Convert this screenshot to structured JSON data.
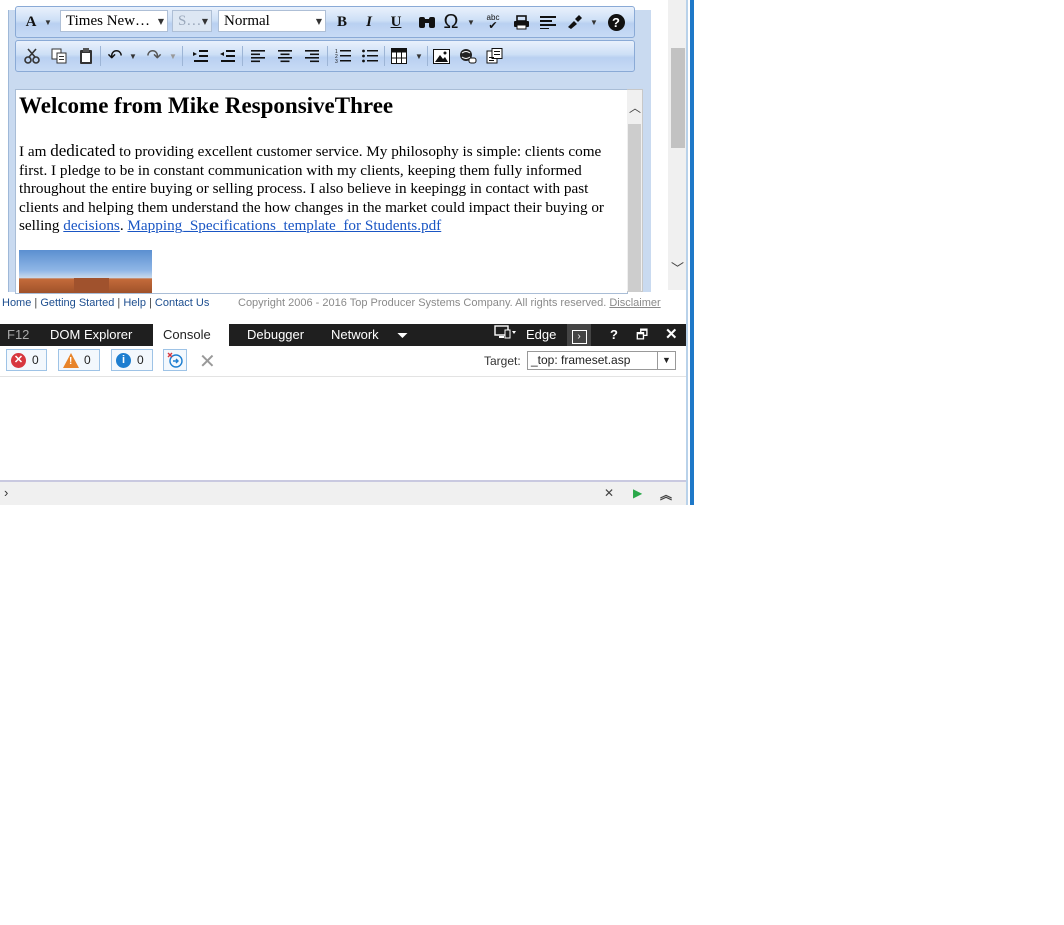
{
  "editor": {
    "toolbar1": {
      "font_name": "Times New…",
      "font_size": "S…",
      "paragraph_format": "Normal",
      "bold": "B",
      "italic": "I",
      "underline": "U",
      "font_color": "A",
      "help": "?",
      "spellcheck": "abc"
    },
    "content": {
      "heading": "Welcome from Mike ResponsiveThree",
      "para_start": "I am ",
      "para_big": "dedicated",
      "para_body": "  to providing excellent customer service. My philosophy is simple: clients come first. I pledge to be in constant communication with my clients, keeping them fully informed throughout the entire buying or selling process. I also believe in keepingg in contact with past clients and helping them understand the how changes in the market could impact their buying or selling ",
      "link1": "decisions",
      "between_links": ". ",
      "link2": "Mapping_Specifications_template_for Students.pdf"
    }
  },
  "footer": {
    "links": [
      "Home",
      "Getting Started",
      "Help",
      "Contact Us"
    ],
    "separator": "|",
    "copyright": "Copyright 2006 - 2016 Top Producer Systems Company. All rights reserved.",
    "disclaimer": "Disclaimer"
  },
  "devtools": {
    "f12": "F12",
    "tabs": [
      "DOM Explorer",
      "Console",
      "Debugger",
      "Network"
    ],
    "active_tab": "Console",
    "emulation": "Edge",
    "help": "?",
    "errors": "0",
    "warnings": "0",
    "messages": "0",
    "target_label": "Target:",
    "target_value": "_top: frameset.asp"
  }
}
